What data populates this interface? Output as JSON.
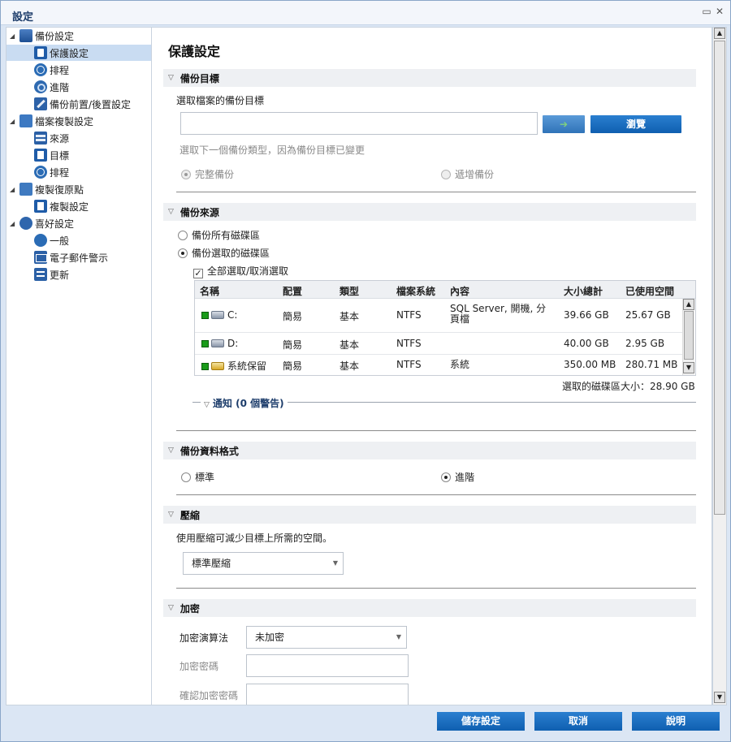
{
  "window": {
    "title": "設定"
  },
  "sidebar": {
    "items": [
      {
        "label": "備份設定"
      },
      {
        "label": "保護設定"
      },
      {
        "label": "排程"
      },
      {
        "label": "進階"
      },
      {
        "label": "備份前置/後置設定"
      },
      {
        "label": "檔案複製設定"
      },
      {
        "label": "來源"
      },
      {
        "label": "目標"
      },
      {
        "label": "排程"
      },
      {
        "label": "複製復原點"
      },
      {
        "label": "複製設定"
      },
      {
        "label": "喜好設定"
      },
      {
        "label": "一般"
      },
      {
        "label": "電子郵件警示"
      },
      {
        "label": "更新"
      }
    ]
  },
  "main": {
    "page_title": "保護設定",
    "backup_destination": {
      "header": "備份目標",
      "prompt": "選取檔案的備份目標",
      "path_value": "",
      "browse_label": "瀏覽",
      "notice": "選取下一個備份類型，因為備份目標已變更",
      "full_backup": "完整備份",
      "incremental_backup": "遞增備份"
    },
    "backup_source": {
      "header": "備份來源",
      "all_volumes": "備份所有磁碟區",
      "selected_volumes": "備份選取的磁碟區",
      "select_all": "全部選取/取消選取",
      "columns": [
        "名稱",
        "配置",
        "類型",
        "檔案系統",
        "內容",
        "大小總計",
        "已使用空間"
      ],
      "rows": [
        {
          "name": "C:",
          "layout": "簡易",
          "type": "基本",
          "fs": "NTFS",
          "contents": "SQL Server, 開機, 分頁檔",
          "total": "39.66 GB",
          "used": "25.67 GB"
        },
        {
          "name": "D:",
          "layout": "簡易",
          "type": "基本",
          "fs": "NTFS",
          "contents": "",
          "total": "40.00 GB",
          "used": "2.95 GB"
        },
        {
          "name": "系統保留",
          "layout": "簡易",
          "type": "基本",
          "fs": "NTFS",
          "contents": "系統",
          "total": "350.00 MB",
          "used": "280.71 MB"
        }
      ],
      "selected_size": "選取的磁碟區大小：28.90 GB",
      "notification": "通知 (0 個警告)"
    },
    "backup_format": {
      "header": "備份資料格式",
      "standard": "標準",
      "advanced": "進階"
    },
    "compression": {
      "header": "壓縮",
      "description": "使用壓縮可減少目標上所需的空間。",
      "selected": "標準壓縮"
    },
    "encryption": {
      "header": "加密",
      "algorithm_label": "加密演算法",
      "algorithm_value": "未加密",
      "password_label": "加密密碼",
      "confirm_label": "確認加密密碼"
    }
  },
  "footer": {
    "save": "儲存設定",
    "cancel": "取消",
    "help": "說明"
  }
}
